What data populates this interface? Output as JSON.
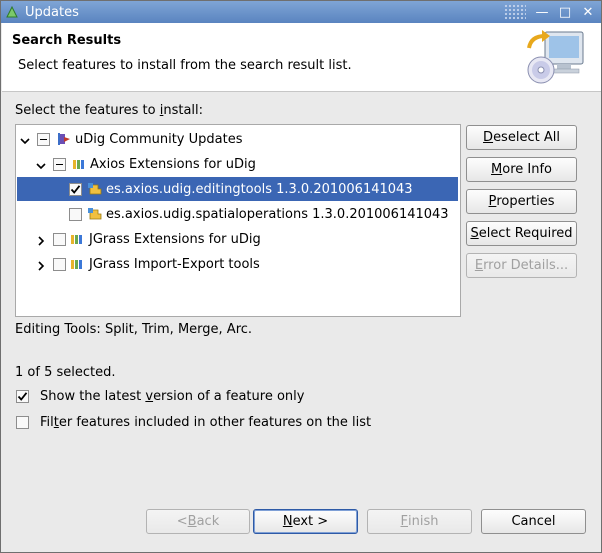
{
  "window": {
    "title": "Updates",
    "minimize_glyph": "—",
    "maximize_glyph": "□",
    "close_glyph": "✕"
  },
  "banner": {
    "heading": "Search Results",
    "description": "Select features to install from the search result list."
  },
  "tree": {
    "label_prefix": "Select the features to ",
    "label_mnemonic": "i",
    "label_suffix": "nstall:",
    "items": [
      {
        "label": "uDig Community Updates",
        "level": 0,
        "expanded": true,
        "check_state": "partial",
        "icon": "update-site-icon"
      },
      {
        "label": "Axios Extensions for uDig",
        "level": 1,
        "expanded": true,
        "check_state": "partial",
        "icon": "category-icon"
      },
      {
        "label": "es.axios.udig.editingtools 1.3.0.201006141043",
        "level": 2,
        "check_state": "checked",
        "icon": "feature-icon",
        "selected": true
      },
      {
        "label": "es.axios.udig.spatialoperations 1.3.0.201006141043",
        "level": 2,
        "check_state": "unchecked",
        "icon": "feature-icon"
      },
      {
        "label": "JGrass Extensions for uDig",
        "level": 0,
        "expanded": false,
        "check_state": "unchecked",
        "icon": "category-icon"
      },
      {
        "label": "JGrass Import-Export tools",
        "level": 0,
        "expanded": false,
        "check_state": "unchecked",
        "icon": "category-icon"
      }
    ]
  },
  "side_buttons": {
    "deselect_all": {
      "pre": "",
      "mn": "D",
      "post": "eselect All"
    },
    "more_info": {
      "pre": "",
      "mn": "M",
      "post": "ore Info"
    },
    "properties": {
      "pre": "",
      "mn": "P",
      "post": "roperties"
    },
    "select_required": {
      "pre": "",
      "mn": "S",
      "post": "elect Required"
    },
    "error_details": {
      "pre": "",
      "mn": "E",
      "post": "rror Details..."
    }
  },
  "details_text": "Editing Tools: Split, Trim, Merge, Arc.",
  "selection_count": "1 of 5 selected.",
  "options": {
    "latest_version": {
      "pre": "Show the latest ",
      "mn": "v",
      "post": "ersion of a feature only",
      "checked": true
    },
    "filter_included": {
      "pre": "Fil",
      "mn": "t",
      "post": "er features included in other features on the list",
      "checked": false
    }
  },
  "footer_buttons": {
    "back": {
      "pre": "< ",
      "mn": "B",
      "post": "ack"
    },
    "next": {
      "pre": "",
      "mn": "N",
      "post": "ext >"
    },
    "finish": {
      "pre": "",
      "mn": "F",
      "post": "inish"
    },
    "cancel": {
      "label": "Cancel"
    }
  },
  "colors": {
    "title_bar": "#5a84c0",
    "selection": "#3b66b4",
    "disabled_text": "#a0a0a0"
  }
}
